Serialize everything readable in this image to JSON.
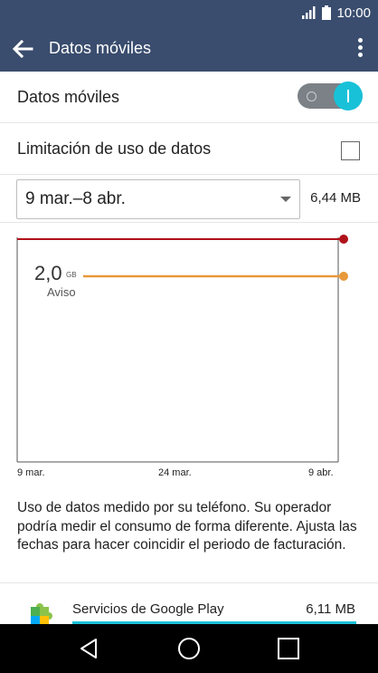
{
  "status_bar": {
    "time": "10:00",
    "icons": [
      "signal-icon",
      "battery-icon"
    ]
  },
  "app_bar": {
    "title": "Datos móviles",
    "back_icon": "back-arrow-icon",
    "menu_icon": "overflow-menu-icon"
  },
  "settings": {
    "mobile_data": {
      "label": "Datos móviles",
      "enabled": true
    },
    "data_limit": {
      "label": "Limitación de uso de datos",
      "checked": false
    }
  },
  "period": {
    "selected": "9 mar.–8 abr.",
    "total_usage": "6,44 MB"
  },
  "chart_data": {
    "type": "line",
    "x_ticks": [
      "9 mar.",
      "24 mar.",
      "9 abr."
    ],
    "warning": {
      "value": "2,0",
      "unit": "GB",
      "label": "Aviso"
    },
    "colors": {
      "limit_line": "#b0121b",
      "warning_line": "#e8993a",
      "axis": "#555555"
    }
  },
  "info": {
    "text": "Uso de datos medido por su teléfono. Su operador podría medir el consumo de forma diferente. Ajusta las fechas para hacer coincidir el periodo de facturación."
  },
  "apps": [
    {
      "name": "Servicios de Google Play",
      "size": "6,11 MB",
      "icon": "puzzle-icon",
      "usage_fraction": 0.95
    }
  ],
  "nav": {
    "back_icon": "nav-back-icon",
    "home_icon": "nav-home-icon",
    "recents_icon": "nav-recents-icon"
  },
  "colors": {
    "app_bar": "#3a4d6e",
    "accent": "#19c1d8"
  }
}
